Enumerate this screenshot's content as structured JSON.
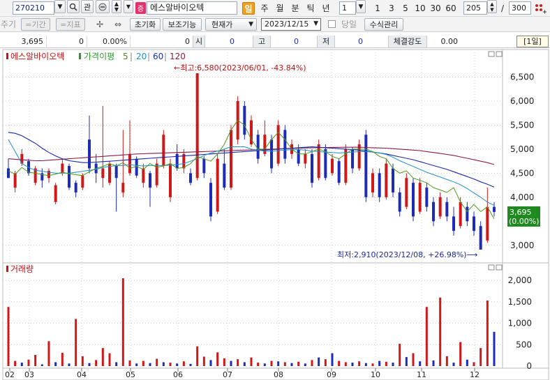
{
  "toolbar": {
    "code": "270210",
    "search_icon": "magnifier-icon",
    "gwan_label": "관",
    "stock_badge": "증",
    "stock_name": "에스알바이오텍",
    "periods": [
      "일",
      "주",
      "월",
      "분",
      "틱",
      "년"
    ],
    "active_period": "일",
    "unit_value": "1",
    "intervals": [
      "1",
      "3",
      "5",
      "10",
      "30",
      "60"
    ],
    "count_value": "205",
    "count_sep": "/",
    "count_max": "300"
  },
  "toolbar2": {
    "disabled": [
      "주기",
      "=기간",
      "=지표"
    ],
    "reset_label": "초기화",
    "aux_label": "보조기능",
    "price_type": "현재가",
    "date_value": "2023/12/15",
    "same_day_label": "당일",
    "formula_label": "수식관리"
  },
  "quote": {
    "price": "3,695",
    "change": "0",
    "change_rate": "0.00%",
    "volume": "0",
    "open_label": "시",
    "open_value": "0",
    "high_label": "고",
    "high_value": "0",
    "low_label": "저",
    "low_value": "0",
    "strength_label": "체결강도",
    "strength_value": "0.00",
    "period_box": "[1일]"
  },
  "chart_data": {
    "type": "candlestick",
    "title": "에스알바이오텍",
    "legend": [
      {
        "name": "에스알바이오텍",
        "color": "#cc1111"
      },
      {
        "name": "가격이평",
        "color": "#2a9a2a"
      },
      {
        "name": "5",
        "color": "#4a8f1a"
      },
      {
        "name": "20",
        "color": "#1f8fc8"
      },
      {
        "name": "60",
        "color": "#1a2aa8"
      },
      {
        "name": "120",
        "color": "#8a1a4a"
      }
    ],
    "x_ticks": [
      "02",
      "03",
      "04",
      "05",
      "06",
      "07",
      "08",
      "09",
      "10",
      "11",
      "12"
    ],
    "price_ticks": [
      "6,500",
      "6,000",
      "5,500",
      "5,000",
      "4,500",
      "4,000",
      "3,000"
    ],
    "price_ylim": [
      2800,
      6800
    ],
    "volume_legend": "거래량",
    "volume_ticks": [
      "2,000",
      "1,500",
      "1,000",
      "500",
      "0"
    ],
    "volume_ylim": [
      0,
      2100
    ],
    "annotations": {
      "high": "←최고:6,580(2023/06/01, -43.84%)",
      "low": "최저:2,910(2023/12/08, +26.98%)⟶"
    },
    "last_price_badge": [
      "3,695",
      "(0.00%)"
    ],
    "ma5": [
      4550,
      4480,
      4620,
      4520,
      4500,
      4470,
      4450,
      4480,
      4520,
      4490,
      4470,
      4450,
      4530,
      4600,
      4640,
      4700,
      4650,
      4720,
      4600,
      4640,
      4580,
      4700,
      4620,
      4650,
      4700,
      4600,
      4620,
      4700,
      4850,
      4800,
      4750,
      4900,
      5100,
      5400,
      5600,
      5500,
      5200,
      5000,
      5000,
      5200,
      5350,
      5200,
      5000,
      4900,
      4900,
      4950,
      5000,
      4950,
      4850,
      4800,
      4900,
      5000,
      5000,
      5000,
      4950,
      4850,
      4800,
      4600,
      4500,
      4550,
      4400,
      4350,
      4300,
      4200,
      4150,
      4100,
      4200,
      3900,
      3700,
      3850,
      3700,
      3800,
      3550
    ],
    "ma20": [
      5200,
      4950,
      4700,
      4620,
      4560,
      4540,
      4520,
      4500,
      4500,
      4500,
      4520,
      4540,
      4560,
      4580,
      4620,
      4640,
      4660,
      4660,
      4680,
      4660,
      4650,
      4660,
      4660,
      4660,
      4670,
      4680,
      4700,
      4750,
      4800,
      4870,
      4920,
      4960,
      5000,
      5050,
      5050,
      5050,
      5000,
      4980,
      4960,
      4960,
      4970,
      4980,
      4990,
      4990,
      4980,
      4960,
      4950,
      4940,
      4930,
      4920,
      4930,
      4940,
      4950,
      4950,
      4940,
      4920,
      4890,
      4830,
      4760,
      4700,
      4640,
      4580,
      4520,
      4470,
      4420,
      4370,
      4320,
      4260,
      4180,
      4090,
      4000,
      3900,
      3830
    ],
    "ma60": [
      5350,
      5330,
      5280,
      5200,
      5120,
      5020,
      4930,
      4860,
      4800,
      4760,
      4740,
      4720,
      4720,
      4730,
      4740,
      4750,
      4760,
      4770,
      4780,
      4790,
      4800,
      4810,
      4820,
      4830,
      4840,
      4850,
      4860,
      4870,
      4880,
      4890,
      4900,
      4910,
      4920,
      4930,
      4940,
      4950,
      4960,
      4970,
      4980,
      4990,
      5000,
      5010,
      5020,
      5030,
      5040,
      5050,
      5040,
      5030,
      5020,
      5010,
      5000,
      4990,
      4980,
      4960,
      4940,
      4920,
      4900,
      4870,
      4840,
      4810,
      4780,
      4740,
      4700,
      4660,
      4620,
      4580,
      4530,
      4480,
      4430,
      4380,
      4320,
      4270,
      4210
    ],
    "ma120": [
      4800,
      4790,
      4780,
      4770,
      4760,
      4760,
      4770,
      4780,
      4790,
      4800,
      4810,
      4820,
      4830,
      4840,
      4850,
      4860,
      4870,
      4880,
      4890,
      4900,
      4905,
      4910,
      4915,
      4920,
      4925,
      4930,
      4935,
      4940,
      4945,
      4950,
      4955,
      4960,
      4965,
      4970,
      4975,
      4980,
      4985,
      4990,
      4995,
      5000,
      5005,
      5010,
      5015,
      5020,
      5025,
      5030,
      5032,
      5034,
      5036,
      5038,
      5040,
      5040,
      5040,
      5035,
      5030,
      5025,
      5020,
      5010,
      5000,
      4990,
      4980,
      4970,
      4950,
      4930,
      4910,
      4890,
      4870,
      4840,
      4810,
      4780,
      4750,
      4720,
      4680
    ],
    "candles": [
      [
        0,
        4600,
        4400,
        4800,
        4400
      ],
      [
        1,
        4200,
        4500,
        4550,
        4100
      ],
      [
        2,
        4700,
        4900,
        5000,
        4650
      ],
      [
        3,
        4750,
        4500,
        4800,
        4450
      ],
      [
        4,
        4300,
        4600,
        4650,
        4250
      ],
      [
        5,
        4500,
        4350,
        4600,
        4200
      ],
      [
        6,
        4400,
        4550,
        4600,
        4300
      ],
      [
        7,
        3900,
        4250,
        4300,
        3850
      ],
      [
        8,
        4500,
        4700,
        4800,
        4450
      ],
      [
        9,
        4650,
        4200,
        4700,
        4150
      ],
      [
        10,
        4300,
        4100,
        4350,
        4000
      ],
      [
        11,
        4200,
        4450,
        4500,
        4150
      ],
      [
        12,
        5200,
        4600,
        5700,
        4500
      ],
      [
        13,
        4700,
        4500,
        4900,
        4300
      ],
      [
        14,
        4400,
        4600,
        5900,
        4200
      ],
      [
        15,
        4300,
        4700,
        4750,
        4250
      ],
      [
        16,
        4650,
        4400,
        4700,
        3700
      ],
      [
        17,
        4100,
        4300,
        5400,
        4000
      ],
      [
        18,
        4500,
        4900,
        5600,
        4450
      ],
      [
        19,
        4800,
        4450,
        4850,
        4400
      ],
      [
        20,
        4300,
        4600,
        4700,
        4200
      ],
      [
        21,
        4500,
        4200,
        4550,
        3800
      ],
      [
        22,
        4250,
        4700,
        4800,
        4200
      ],
      [
        23,
        4650,
        5300,
        5400,
        4600
      ],
      [
        24,
        4000,
        4700,
        4800,
        3900
      ],
      [
        25,
        4900,
        4600,
        5100,
        4550
      ],
      [
        26,
        4600,
        4900,
        5000,
        4500
      ],
      [
        27,
        4500,
        4300,
        4600,
        4250
      ],
      [
        28,
        4400,
        6580,
        6580,
        4350
      ],
      [
        29,
        4800,
        4500,
        4850,
        4400
      ],
      [
        30,
        4300,
        3600,
        4400,
        3500
      ],
      [
        31,
        3700,
        4800,
        4900,
        3650
      ],
      [
        32,
        4700,
        4200,
        5000,
        4150
      ],
      [
        33,
        4200,
        5400,
        5500,
        4150
      ],
      [
        34,
        5200,
        6000,
        6100,
        5100
      ],
      [
        35,
        5900,
        5300,
        6000,
        5200
      ],
      [
        36,
        5100,
        5600,
        5700,
        5050
      ],
      [
        37,
        5300,
        4800,
        5400,
        4700
      ],
      [
        38,
        4900,
        5300,
        5600,
        4850
      ],
      [
        39,
        5200,
        4600,
        5300,
        4500
      ],
      [
        40,
        4700,
        5500,
        5600,
        4650
      ],
      [
        41,
        5400,
        4800,
        5500,
        4700
      ],
      [
        42,
        4900,
        5100,
        5200,
        4800
      ],
      [
        43,
        5000,
        4700,
        5100,
        4650
      ],
      [
        44,
        4700,
        4900,
        5000,
        4600
      ],
      [
        45,
        4900,
        4300,
        5000,
        4200
      ],
      [
        46,
        4400,
        5100,
        5200,
        4350
      ],
      [
        47,
        5000,
        4400,
        5100,
        4350
      ],
      [
        48,
        4500,
        4800,
        4900,
        4450
      ],
      [
        49,
        4750,
        4300,
        4800,
        4250
      ],
      [
        50,
        4300,
        5000,
        5100,
        4250
      ],
      [
        51,
        5000,
        4600,
        5050,
        4500
      ],
      [
        52,
        4600,
        5100,
        5200,
        4550
      ],
      [
        53,
        5300,
        4000,
        5400,
        3900
      ],
      [
        54,
        4100,
        4500,
        4600,
        4000
      ],
      [
        55,
        4500,
        4000,
        4600,
        3900
      ],
      [
        56,
        4000,
        4700,
        4800,
        3950
      ],
      [
        57,
        4600,
        4100,
        4700,
        4000
      ],
      [
        58,
        4100,
        3700,
        4200,
        3600
      ],
      [
        59,
        3800,
        4400,
        4500,
        3750
      ],
      [
        60,
        4300,
        3600,
        4400,
        3500
      ],
      [
        61,
        3700,
        4300,
        4400,
        3650
      ],
      [
        62,
        4200,
        3800,
        4300,
        3700
      ],
      [
        63,
        3900,
        3500,
        4000,
        3400
      ],
      [
        64,
        3600,
        4000,
        4100,
        3550
      ],
      [
        65,
        3900,
        3600,
        4000,
        3500
      ],
      [
        66,
        3600,
        3300,
        3800,
        3200
      ],
      [
        67,
        3400,
        3900,
        4000,
        3350
      ],
      [
        68,
        3800,
        3500,
        3900,
        3400
      ],
      [
        69,
        3600,
        3300,
        3700,
        3200
      ],
      [
        70,
        3400,
        2910,
        3500,
        2910
      ],
      [
        71,
        3100,
        3800,
        4200,
        3050
      ],
      [
        72,
        3800,
        3695,
        3900,
        3600
      ]
    ],
    "volumes": [
      [
        0,
        1380,
        1
      ],
      [
        1,
        120,
        1
      ],
      [
        2,
        80,
        0
      ],
      [
        3,
        150,
        1
      ],
      [
        4,
        260,
        1
      ],
      [
        5,
        40,
        0
      ],
      [
        6,
        580,
        1
      ],
      [
        7,
        90,
        0
      ],
      [
        8,
        310,
        1
      ],
      [
        9,
        60,
        0
      ],
      [
        10,
        1100,
        1
      ],
      [
        11,
        230,
        1
      ],
      [
        12,
        70,
        0
      ],
      [
        13,
        140,
        1
      ],
      [
        14,
        420,
        1
      ],
      [
        15,
        300,
        1
      ],
      [
        16,
        90,
        0
      ],
      [
        17,
        2050,
        1
      ],
      [
        18,
        130,
        1
      ],
      [
        19,
        60,
        0
      ],
      [
        20,
        120,
        1
      ],
      [
        21,
        70,
        0
      ],
      [
        22,
        170,
        1
      ],
      [
        23,
        90,
        0
      ],
      [
        24,
        80,
        1
      ],
      [
        25,
        60,
        0
      ],
      [
        26,
        110,
        1
      ],
      [
        27,
        50,
        0
      ],
      [
        28,
        460,
        1
      ],
      [
        29,
        220,
        1
      ],
      [
        30,
        140,
        0
      ],
      [
        31,
        320,
        1
      ],
      [
        32,
        180,
        1
      ],
      [
        33,
        120,
        0
      ],
      [
        34,
        160,
        1
      ],
      [
        35,
        90,
        0
      ],
      [
        36,
        200,
        1
      ],
      [
        37,
        80,
        1
      ],
      [
        38,
        60,
        0
      ],
      [
        39,
        120,
        1
      ],
      [
        40,
        110,
        0
      ],
      [
        41,
        90,
        1
      ],
      [
        42,
        70,
        0
      ],
      [
        43,
        100,
        1
      ],
      [
        44,
        60,
        0
      ],
      [
        45,
        140,
        1
      ],
      [
        46,
        200,
        0
      ],
      [
        47,
        160,
        1
      ],
      [
        48,
        300,
        0
      ],
      [
        49,
        120,
        1
      ],
      [
        50,
        90,
        1
      ],
      [
        51,
        80,
        0
      ],
      [
        52,
        110,
        1
      ],
      [
        53,
        70,
        0
      ],
      [
        54,
        60,
        1
      ],
      [
        55,
        120,
        0
      ],
      [
        56,
        100,
        1
      ],
      [
        57,
        80,
        0
      ],
      [
        58,
        520,
        1
      ],
      [
        59,
        210,
        0
      ],
      [
        60,
        300,
        1
      ],
      [
        61,
        110,
        0
      ],
      [
        62,
        1380,
        1
      ],
      [
        63,
        130,
        0
      ],
      [
        64,
        1600,
        1
      ],
      [
        65,
        230,
        1
      ],
      [
        66,
        80,
        0
      ],
      [
        67,
        560,
        1
      ],
      [
        68,
        150,
        0
      ],
      [
        69,
        90,
        1
      ],
      [
        70,
        420,
        1
      ],
      [
        71,
        1530,
        1
      ],
      [
        72,
        800,
        0
      ]
    ]
  }
}
